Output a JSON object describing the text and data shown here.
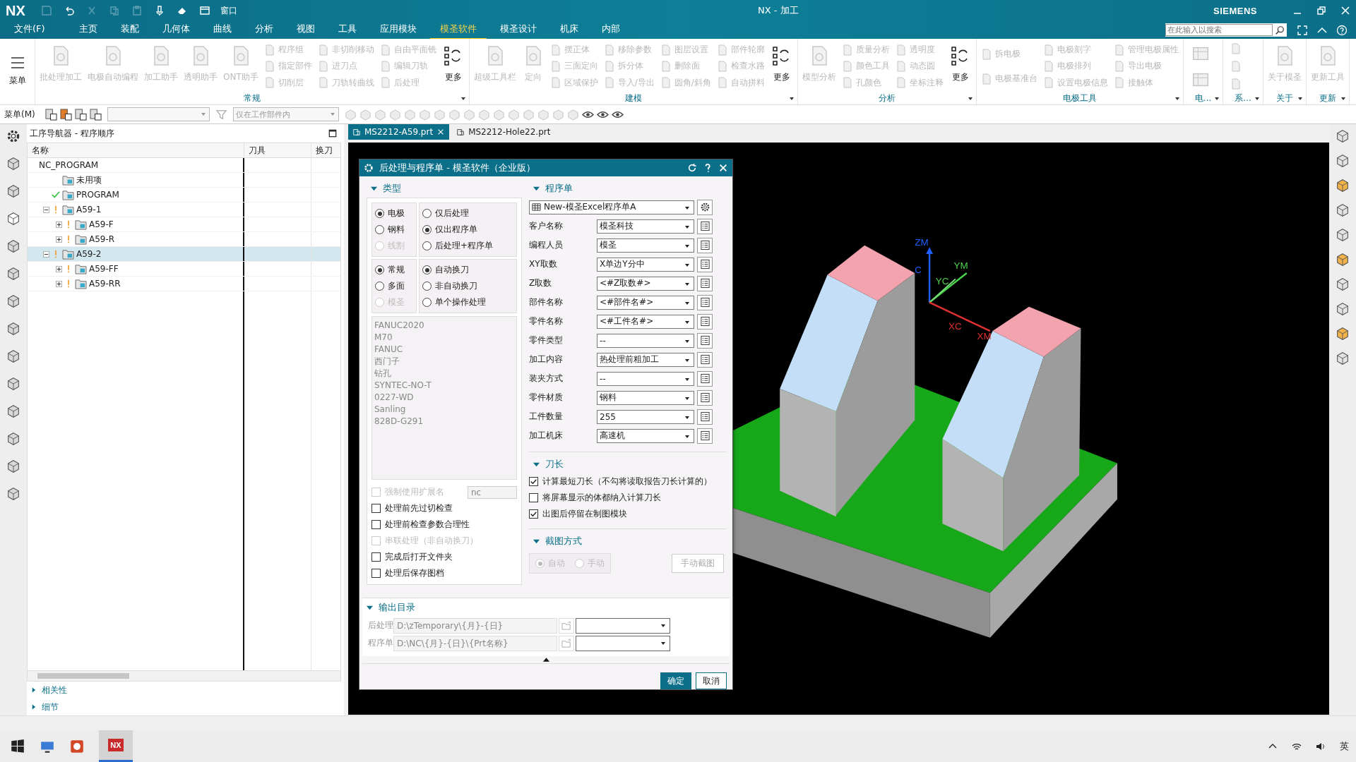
{
  "title_bar": {
    "logo": "NX",
    "window_menu": "窗口",
    "title": "NX - 加工",
    "brand": "SIEMENS"
  },
  "menu_tabs": [
    {
      "label": "文件(F)",
      "selected": false
    },
    {
      "label": "主页",
      "selected": false
    },
    {
      "label": "装配",
      "selected": false
    },
    {
      "label": "几何体",
      "selected": false
    },
    {
      "label": "曲线",
      "selected": false
    },
    {
      "label": "分析",
      "selected": false
    },
    {
      "label": "视图",
      "selected": false
    },
    {
      "label": "工具",
      "selected": false
    },
    {
      "label": "应用模块",
      "selected": false
    },
    {
      "label": "模圣软件",
      "selected": true
    },
    {
      "label": "模圣设计",
      "selected": false
    },
    {
      "label": "机床",
      "selected": false
    },
    {
      "label": "内部",
      "selected": false
    }
  ],
  "search": {
    "placeholder": "在此输入以搜索"
  },
  "ribbon": {
    "menu_button": "菜单",
    "groups": [
      {
        "label": "常规",
        "columns": [
          {
            "kind": "large",
            "label": "批处理加工",
            "disabled": true
          },
          {
            "kind": "large",
            "label": "电极自动编程",
            "disabled": true
          },
          {
            "kind": "large",
            "label": "加工助手",
            "disabled": true
          },
          {
            "kind": "large",
            "label": "透明助手",
            "disabled": true
          },
          {
            "kind": "large",
            "label": "ONT助手",
            "disabled": true
          },
          {
            "kind": "stack",
            "items": [
              {
                "label": "程序组",
                "disabled": true
              },
              {
                "label": "指定部件",
                "disabled": true
              },
              {
                "label": "切削层",
                "disabled": true
              }
            ]
          },
          {
            "kind": "stack",
            "items": [
              {
                "label": "非切削移动",
                "disabled": true
              },
              {
                "label": "进刀点",
                "disabled": true
              },
              {
                "label": "刀轨转曲线",
                "disabled": true
              }
            ]
          },
          {
            "kind": "stack",
            "items": [
              {
                "label": "自由平面铣",
                "disabled": true
              },
              {
                "label": "编辑刀轨",
                "disabled": true
              },
              {
                "label": "后处理",
                "disabled": true
              }
            ]
          },
          {
            "kind": "large",
            "label": "更多",
            "disabled": false
          }
        ]
      },
      {
        "label": "建模",
        "columns": [
          {
            "kind": "large",
            "label": "超级工具栏",
            "disabled": true
          },
          {
            "kind": "large",
            "label": "定向",
            "disabled": true
          },
          {
            "kind": "stack",
            "items": [
              {
                "label": "摆正体",
                "disabled": true
              },
              {
                "label": "三面定向",
                "disabled": true
              },
              {
                "label": "区域保护",
                "disabled": true
              }
            ]
          },
          {
            "kind": "stack",
            "items": [
              {
                "label": "移除参数",
                "disabled": true
              },
              {
                "label": "拆分体",
                "disabled": true
              },
              {
                "label": "导入/导出",
                "disabled": true
              }
            ]
          },
          {
            "kind": "stack",
            "items": [
              {
                "label": "图层设置",
                "disabled": true
              },
              {
                "label": "删除面",
                "disabled": true
              },
              {
                "label": "圆角/斜角",
                "disabled": true
              }
            ]
          },
          {
            "kind": "stack",
            "items": [
              {
                "label": "部件轮廓",
                "disabled": true
              },
              {
                "label": "检查水路",
                "disabled": true
              },
              {
                "label": "自动拼料",
                "disabled": true
              }
            ]
          },
          {
            "kind": "large",
            "label": "更多",
            "disabled": false
          }
        ]
      },
      {
        "label": "分析",
        "columns": [
          {
            "kind": "large",
            "label": "模型分析",
            "disabled": true
          },
          {
            "kind": "stack",
            "items": [
              {
                "label": "质量分析",
                "disabled": true
              },
              {
                "label": "颜色工具",
                "disabled": true
              },
              {
                "label": "孔颜色",
                "disabled": true
              }
            ]
          },
          {
            "kind": "stack",
            "items": [
              {
                "label": "透明度",
                "disabled": true
              },
              {
                "label": "动态圆",
                "disabled": true
              },
              {
                "label": "坐标注释",
                "disabled": true
              }
            ]
          },
          {
            "kind": "large",
            "label": "更多",
            "disabled": false
          }
        ]
      },
      {
        "label": "电极工具",
        "columns": [
          {
            "kind": "stack",
            "items": [
              {
                "label": "拆电极",
                "disabled": true
              },
              {
                "label": "电极基准台",
                "disabled": true
              }
            ]
          },
          {
            "kind": "stack",
            "items": [
              {
                "label": "电极刻字",
                "disabled": true
              },
              {
                "label": "电极排列",
                "disabled": true
              },
              {
                "label": "设置电极信息",
                "disabled": true
              }
            ]
          },
          {
            "kind": "stack",
            "items": [
              {
                "label": "管理电极属性",
                "disabled": true
              },
              {
                "label": "导出电极",
                "disabled": true
              },
              {
                "label": "接触体",
                "disabled": true
              }
            ]
          }
        ]
      },
      {
        "label": "电...",
        "columns": [
          {
            "kind": "icons",
            "icons": [
              {
                "kind": "large"
              },
              {
                "kind": "large"
              }
            ]
          }
        ]
      },
      {
        "label": "系...",
        "columns": [
          {
            "kind": "icons",
            "icons": [
              {
                "kind": "small"
              },
              {
                "kind": "small"
              },
              {
                "kind": "small"
              }
            ]
          }
        ]
      },
      {
        "label": "关于",
        "columns": [
          {
            "kind": "large",
            "label": "关于模圣",
            "disabled": true
          }
        ]
      },
      {
        "label": "更新",
        "columns": [
          {
            "kind": "large",
            "label": "更新工具",
            "disabled": true
          }
        ]
      }
    ]
  },
  "toolbar": {
    "menu": "菜单(M)",
    "scope": "仅在工作部件内"
  },
  "navigator": {
    "title": "工序导航器 - 程序顺序",
    "columns": [
      "名称",
      "刀具",
      "换刀"
    ],
    "tree": [
      {
        "label": "NC_PROGRAM",
        "complete": false,
        "warning": false,
        "selected": false,
        "children": [
          {
            "label": "未用项",
            "complete": false,
            "warning": false,
            "selected": false
          },
          {
            "label": "PROGRAM",
            "complete": true,
            "warning": false,
            "selected": false
          },
          {
            "label": "A59-1",
            "complete": false,
            "warning": true,
            "selected": false,
            "expanded": true,
            "children": [
              {
                "label": "A59-F",
                "complete": false,
                "warning": true,
                "selected": false,
                "expanded": false
              },
              {
                "label": "A59-R",
                "complete": false,
                "warning": true,
                "selected": false,
                "expanded": false
              }
            ]
          },
          {
            "label": "A59-2",
            "complete": false,
            "warning": true,
            "selected": true,
            "expanded": true,
            "children": [
              {
                "label": "A59-FF",
                "complete": false,
                "warning": true,
                "selected": false,
                "expanded": false
              },
              {
                "label": "A59-RR",
                "complete": false,
                "warning": true,
                "selected": false,
                "expanded": false
              }
            ]
          }
        ]
      }
    ],
    "sections": [
      {
        "label": "相关性",
        "expanded": false
      },
      {
        "label": "细节",
        "expanded": false
      }
    ]
  },
  "viewport": {
    "tabs": [
      {
        "label": "MS2212-A59.prt",
        "selected": true
      },
      {
        "label": "MS2212-Hole22.prt",
        "selected": false
      }
    ],
    "axis_labels": [
      {
        "label": "ZM",
        "kind": "z"
      },
      {
        "label": "C",
        "kind": "zc"
      },
      {
        "label": "YM",
        "kind": "y"
      },
      {
        "label": "YC",
        "kind": "yc"
      },
      {
        "label": "XC",
        "kind": "xc"
      },
      {
        "label": "XM",
        "kind": "x"
      }
    ]
  },
  "dialog": {
    "title": "后处理与程序单 - 模圣软件（企业版）",
    "type_section": {
      "title": "类型",
      "expanded": true,
      "radio_groups": [
        [
          {
            "label": "电极",
            "selected": true,
            "disabled": false
          },
          {
            "label": "钢料",
            "selected": false,
            "disabled": false
          },
          {
            "label": "线割",
            "selected": false,
            "disabled": true
          }
        ],
        [
          {
            "label": "仅后处理",
            "selected": false,
            "disabled": false
          },
          {
            "label": "仅出程序单",
            "selected": true,
            "disabled": false
          },
          {
            "label": "后处理+程序单",
            "selected": false,
            "disabled": false
          }
        ],
        [
          {
            "label": "常规",
            "selected": true,
            "disabled": false
          },
          {
            "label": "多面",
            "selected": false,
            "disabled": false
          },
          {
            "label": "模圣",
            "selected": false,
            "disabled": true
          }
        ],
        [
          {
            "label": "自动换刀",
            "selected": true,
            "disabled": false
          },
          {
            "label": "非自动换刀",
            "selected": false,
            "disabled": false
          },
          {
            "label": "单个操作处理",
            "selected": false,
            "disabled": false
          }
        ]
      ],
      "post_list": [
        "FANUC2020",
        "M70",
        "FANUC",
        "西门子",
        "钻孔",
        "SYNTEC-NO-T",
        "0227-WD",
        "Sanling",
        "828D-G291"
      ],
      "extension": {
        "label": "强制使用扩展名",
        "checked": false,
        "disabled": true,
        "value": "nc"
      },
      "options": [
        {
          "label": "处理前先过切检查",
          "checked": false,
          "disabled": false
        },
        {
          "label": "处理前检查参数合理性",
          "checked": false,
          "disabled": false
        },
        {
          "label": "串联处理（非自动换刀）",
          "checked": false,
          "disabled": true
        },
        {
          "label": "完成后打开文件夹",
          "checked": false,
          "disabled": false
        },
        {
          "label": "处理后保存图档",
          "checked": false,
          "disabled": false
        }
      ]
    },
    "program_sheet": {
      "title": "程序单",
      "expanded": true,
      "template": "New-模圣Excel程序单A",
      "fields": [
        {
          "label": "客户名称",
          "value": "模圣科技"
        },
        {
          "label": "编程人员",
          "value": "模圣"
        },
        {
          "label": "XY取数",
          "value": "X单边Y分中"
        },
        {
          "label": "Z取数",
          "value": "<#Z取数#>"
        },
        {
          "label": "部件名称",
          "value": "<#部件名#>"
        },
        {
          "label": "零件名称",
          "value": "<#工件名#>"
        },
        {
          "label": "零件类型",
          "value": "--"
        },
        {
          "label": "加工内容",
          "value": "热处理前粗加工"
        },
        {
          "label": "装夹方式",
          "value": "--"
        },
        {
          "label": "零件材质",
          "value": "钢料"
        },
        {
          "label": "工件数量",
          "value": "255"
        },
        {
          "label": "加工机床",
          "value": "高速机"
        }
      ]
    },
    "tool_length": {
      "title": "刀长",
      "expanded": true,
      "options": [
        {
          "label": "计算最短刀长（不勾将读取报告刀长计算的）",
          "checked": true
        },
        {
          "label": "将屏幕显示的体都纳入计算刀长",
          "checked": false
        },
        {
          "label": "出图后停留在制图模块",
          "checked": true
        }
      ]
    },
    "screenshot": {
      "title": "截图方式",
      "expanded": true,
      "modes": [
        {
          "label": "自动",
          "selected": true,
          "disabled": true
        },
        {
          "label": "手动",
          "selected": false,
          "disabled": true
        }
      ],
      "button": {
        "label": "手动截图",
        "disabled": true
      }
    },
    "output": {
      "title": "输出目录",
      "expanded": true,
      "rows": [
        {
          "label": "后处理",
          "path": "D:\\zTemporary\\{月}-{日}"
        },
        {
          "label": "程序单",
          "path": "D:\\NC\\{月}-{日}\\{Prt名称}"
        }
      ]
    },
    "buttons": [
      {
        "label": "确定",
        "kind": "primary"
      },
      {
        "label": "取消",
        "kind": "secondary"
      }
    ]
  },
  "taskbar": {
    "active_app": "NX",
    "input_method": "英"
  }
}
